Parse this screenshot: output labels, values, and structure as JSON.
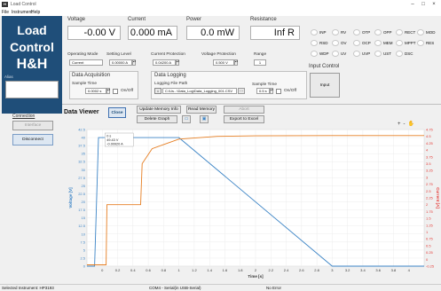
{
  "window": {
    "title": "Load Control",
    "app_icon_text": "H"
  },
  "menu": [
    "File",
    "Instrument",
    "Help"
  ],
  "brand": {
    "line1": "Load",
    "line2": "Control",
    "line3": "H&H",
    "alias_label": "Alias"
  },
  "readouts": {
    "voltage": {
      "label": "Voltage",
      "value": "-0.00 V"
    },
    "current": {
      "label": "Current",
      "value": "0.000 mA"
    },
    "power": {
      "label": "Power",
      "value": "0.0 mW"
    },
    "resistance": {
      "label": "Resistance",
      "value": "Inf R"
    }
  },
  "settings": {
    "mode_label": "Operating Mode",
    "mode_value": "Current",
    "level_label": "Setting Level",
    "level_value": "0.00000 A",
    "cprot_label": "Current Protection",
    "cprot_value": "0.04200 A",
    "vprot_label": "Voltage Protection",
    "vprot_value": "0.500 V",
    "range_label": "Range",
    "range_value": "1"
  },
  "acquisition": {
    "title": "Data Acquisition",
    "sample_label": "Sample Time",
    "sample_value": "0.0002 s",
    "onoff": "On/Off"
  },
  "logging": {
    "title": "Data Logging",
    "path_label": "Logging File Path",
    "path_value": "C:\\Us...\\Data_Log\\Data_Logging_001.CSV",
    "browse": "...",
    "sample_label": "Sample Time",
    "sample_value": "0.5 s",
    "onoff": "On/Off"
  },
  "status_leds": [
    "INP",
    "RV",
    "OTP",
    "OPP",
    "RECT",
    "MOD",
    "RSD",
    "OV",
    "OCP",
    "MEM",
    "MPPT",
    "RES",
    "WDP",
    "UV",
    "UVP",
    "UST",
    "DSC"
  ],
  "input_control": {
    "label": "Input Control",
    "button": "Input"
  },
  "sidebar": {
    "connection_label": "Connection",
    "interface_btn": "Interface",
    "disconnect_btn": "Disconnect"
  },
  "viewer": {
    "title": "Data Viewer",
    "close_btn": "Close",
    "update_btn": "Update Memory Info",
    "read_btn": "Read Memory",
    "abort_btn": "Abort",
    "delete_btn": "Delete Graph",
    "export_btn": "Export to Excel",
    "cursor_lines": [
      "0 s",
      "49.43 V",
      "-0.00920 A"
    ],
    "tool_icons": [
      "+",
      "-",
      "hand"
    ]
  },
  "chart_data": {
    "type": "line",
    "xlabel": "Time [s]",
    "ylabel_left": "Voltage [V]",
    "ylabel_right": "Current [A]",
    "xlim": [
      -0.2,
      4.2
    ],
    "ylim_left": [
      0,
      42.5
    ],
    "ylim_right": [
      -0.25,
      4.75
    ],
    "x_ticks": [
      "0",
      "0.2",
      "0.4",
      "0.6",
      "0.8",
      "1",
      "1.2",
      "1.4",
      "1.6",
      "1.8",
      "2",
      "2.2",
      "2.4",
      "2.6",
      "2.8",
      "3",
      "3.2",
      "3.4",
      "3.6",
      "3.8",
      "4"
    ],
    "y_left_ticks": [
      "0",
      "2.5",
      "5",
      "7.5",
      "10",
      "12.5",
      "15",
      "17.5",
      "20",
      "22.5",
      "25",
      "27.5",
      "30",
      "32.5",
      "35",
      "37.5",
      "40",
      "42.5"
    ],
    "y_right_ticks": [
      "-0.25",
      "0",
      "0.25",
      "0.5",
      "0.75",
      "1",
      "1.25",
      "1.5",
      "1.75",
      "2",
      "2.25",
      "2.5",
      "2.75",
      "3",
      "3.25",
      "3.5",
      "3.75",
      "4",
      "4.25",
      "4.5",
      "4.75"
    ],
    "series": [
      {
        "axis": "left",
        "color": "#3d85c6",
        "x": [
          -0.2,
          -0.1,
          -0.05,
          0,
          1,
          3,
          4.2
        ],
        "y": [
          0,
          0,
          40,
          40,
          40,
          0,
          0
        ]
      },
      {
        "axis": "right",
        "color": "#e67e22",
        "x": [
          -0.2,
          0.05,
          0.06,
          0.5,
          0.52,
          0.65,
          0.8,
          1,
          1.5,
          2,
          3,
          4.2
        ],
        "y": [
          -0.2,
          -0.2,
          2.0,
          2.0,
          3.5,
          4.05,
          4.2,
          4.4,
          4.5,
          4.52,
          4.53,
          4.53
        ]
      }
    ]
  },
  "statusbar": {
    "left": "Selected Instrument: HP3193",
    "mid": "COM4 - Serial(in USB-Serial)",
    "right": "No Error"
  }
}
